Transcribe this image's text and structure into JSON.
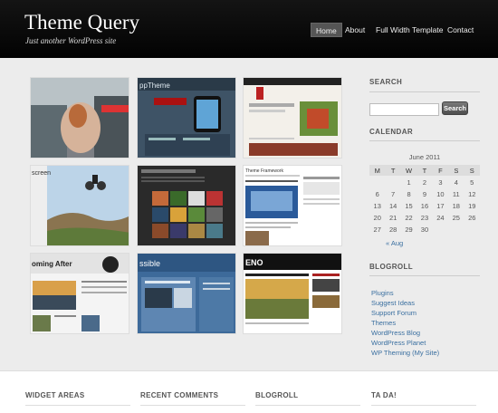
{
  "site": {
    "title": "Theme Query",
    "description": "Just another WordPress site"
  },
  "nav": {
    "items": [
      "Home",
      "About",
      "Full Width Template",
      "Contact"
    ],
    "active": "Home"
  },
  "gallery": {
    "thumbnails": [
      {
        "subject": "egg-in-hand"
      },
      {
        "subject": "phone-theme",
        "caption": "ppTheme"
      },
      {
        "subject": "red-theme-page"
      },
      {
        "subject": "bmx-rider",
        "caption": "screen"
      },
      {
        "subject": "dark-photo-grid-theme"
      },
      {
        "subject": "framework-theme",
        "caption": "Theme Framework"
      },
      {
        "subject": "morning-after-theme",
        "caption": "oming After"
      },
      {
        "subject": "blue-theme",
        "caption": "ssible"
      },
      {
        "subject": "dark-magazine-theme",
        "caption": "ENO"
      }
    ]
  },
  "sidebar": {
    "search": {
      "heading": "SEARCH",
      "value": "",
      "button": "Search"
    },
    "calendar": {
      "heading": "CALENDAR",
      "caption": "June 2011",
      "days": [
        "M",
        "T",
        "W",
        "T",
        "F",
        "S",
        "S"
      ],
      "weeks": [
        [
          "",
          "",
          "1",
          "2",
          "3",
          "4",
          "5"
        ],
        [
          "6",
          "7",
          "8",
          "9",
          "10",
          "11",
          "12"
        ],
        [
          "13",
          "14",
          "15",
          "16",
          "17",
          "18",
          "19"
        ],
        [
          "20",
          "21",
          "22",
          "23",
          "24",
          "25",
          "26"
        ],
        [
          "27",
          "28",
          "29",
          "30",
          "",
          "",
          ""
        ]
      ],
      "prev_link": "« Aug"
    },
    "blogroll": {
      "heading": "BLOGROLL",
      "links": [
        "Plugins",
        "Suggest Ideas",
        "Support Forum",
        "Themes",
        "WordPress Blog",
        "WordPress Planet",
        "WP Theming (My Site)"
      ]
    }
  },
  "footer": {
    "headings": [
      "WIDGET AREAS",
      "RECENT COMMENTS",
      "BLOGROLL",
      "TA DA!"
    ]
  },
  "colors": {
    "header_bg": "#0a0a0a",
    "page_bg": "#ececec",
    "link": "#3a6fa0",
    "nav_active_bg": "#555555"
  }
}
